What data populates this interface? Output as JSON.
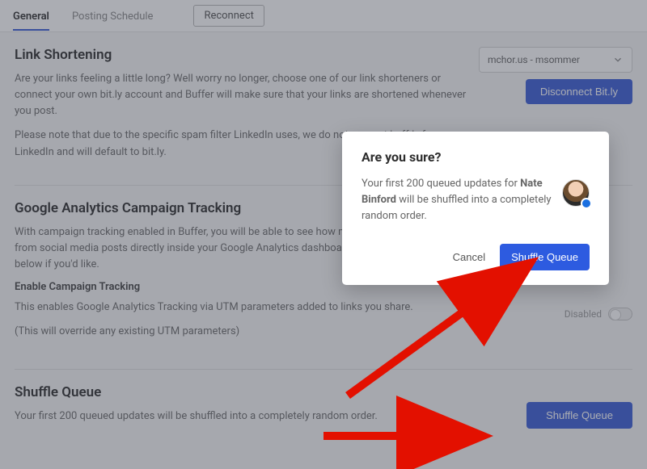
{
  "tabs": {
    "general": "General",
    "posting": "Posting Schedule",
    "reconnect": "Reconnect"
  },
  "link_shortening": {
    "title": "Link Shortening",
    "p1": "Are your links feeling a little long? Well worry no longer, choose one of our link shorteners or connect your own bit.ly account and Buffer will make sure that your links are shortened whenever you post.",
    "p2": "Please note that due to the specific spam filter LinkedIn uses, we do not support buff.ly for LinkedIn and will default to bit.ly.",
    "select_value": "mchor.us - msommer",
    "disconnect": "Disconnect Bit.ly"
  },
  "ga": {
    "title": "Google Analytics Campaign Tracking",
    "p1": "With campaign tracking enabled in Buffer, you will be able to see how much traffic you receive from social media posts directly inside your Google Analytics dashboard. You can disable this below if you'd like.",
    "sub": "Enable Campaign Tracking",
    "p2": "This enables Google Analytics Tracking via UTM parameters added to links you share.",
    "p3": "(This will override any existing UTM parameters)",
    "toggle_label": "Disabled"
  },
  "shuffle": {
    "title": "Shuffle Queue",
    "desc": "Your first 200 queued updates will be shuffled into a completely random order.",
    "button": "Shuffle Queue"
  },
  "modal": {
    "title": "Are you sure?",
    "line_a": "Your first 200 queued updates for ",
    "name": "Nate Binford",
    "line_b": " will be shuffled into a completely random order.",
    "cancel": "Cancel",
    "confirm": "Shuffle Queue"
  }
}
